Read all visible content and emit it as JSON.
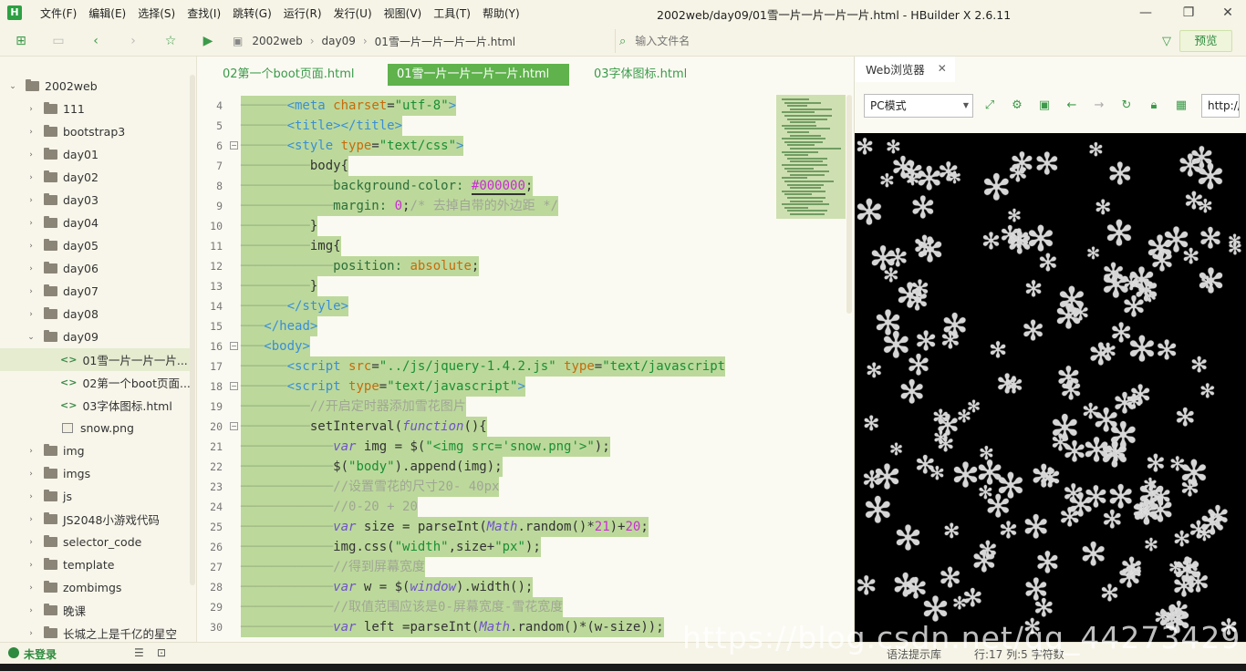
{
  "menu": [
    "文件(F)",
    "编辑(E)",
    "选择(S)",
    "查找(I)",
    "跳转(G)",
    "运行(R)",
    "发行(U)",
    "视图(V)",
    "工具(T)",
    "帮助(Y)"
  ],
  "window_title": "2002web/day09/01雪一片一片一片一片.html - HBuilder X 2.6.11",
  "breadcrumb": [
    "2002web",
    "day09",
    "01雪一片一片一片一片.html"
  ],
  "file_search_placeholder": "输入文件名",
  "preview_label": "预览",
  "sidebar": {
    "root": "2002web",
    "items": [
      "111",
      "bootstrap3",
      "day01",
      "day02",
      "day03",
      "day04",
      "day05",
      "day06",
      "day07",
      "day08"
    ],
    "open_folder": "day09",
    "children": [
      "01雪一片一片一片...",
      "02第一个boot页面...",
      "03字体图标.html",
      "snow.png"
    ],
    "items_after": [
      "img",
      "imgs",
      "js",
      "JS2048小游戏代码",
      "selector_code",
      "template",
      "zombimgs",
      "晚课",
      "长城之上是千亿的星空"
    ]
  },
  "tabs": [
    "02第一个boot页面.html",
    "01雪一片一片一片一片.html",
    "03字体图标.html"
  ],
  "code_line_numbers": [
    "4",
    "5",
    "6",
    "7",
    "8",
    "9",
    "10",
    "11",
    "12",
    "13",
    "14",
    "15",
    "16",
    "17",
    "18",
    "19",
    "20",
    "21",
    "22",
    "23",
    "24",
    "25",
    "26",
    "27",
    "28",
    "29",
    "30"
  ],
  "browser": {
    "tab_label": "Web浏览器",
    "close": "✕",
    "mode": "PC模式",
    "url": "http://"
  },
  "status": {
    "login": "未登录",
    "message": "语法提示库",
    "position": "行:17 列:5 字符数"
  },
  "watermark": "https://blog.csdn.net/qq_44273429"
}
